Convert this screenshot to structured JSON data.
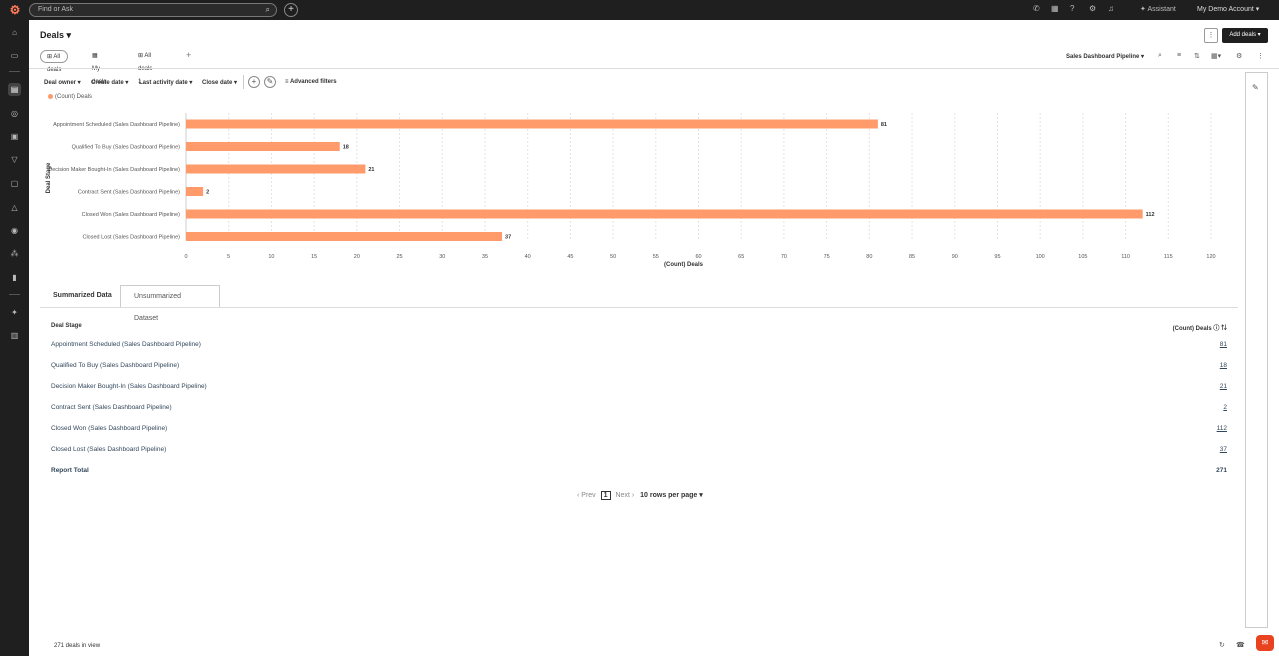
{
  "topbar": {
    "search_placeholder": "Find or Ask",
    "assistant_label": "Assistant",
    "account_label": "My Demo Account"
  },
  "header": {
    "title": "Deals",
    "add_deals_label": "Add deals",
    "pipeline_label": "Sales Dashboard Pipeline",
    "views": [
      "All deals",
      "My deals",
      "All deals-1"
    ]
  },
  "filters": {
    "items": [
      "Deal owner",
      "Create date",
      "Last activity date",
      "Close date"
    ],
    "advanced_label": "Advanced filters"
  },
  "legend": {
    "label": "(Count) Deals"
  },
  "chart_data": {
    "type": "bar",
    "orientation": "horizontal",
    "categories": [
      "Appointment Scheduled (Sales Dashboard Pipeline)",
      "Qualified To Buy (Sales Dashboard Pipeline)",
      "Decision Maker Bought-In (Sales Dashboard Pipeline)",
      "Contract Sent (Sales Dashboard Pipeline)",
      "Closed Won (Sales Dashboard Pipeline)",
      "Closed Lost (Sales Dashboard Pipeline)"
    ],
    "values": [
      81,
      18,
      21,
      2,
      112,
      37
    ],
    "xlabel": "(Count) Deals",
    "ylabel": "Deal Stage",
    "xlim": [
      0,
      120
    ],
    "xticks": [
      0,
      5,
      10,
      15,
      20,
      25,
      30,
      35,
      40,
      45,
      50,
      55,
      60,
      65,
      70,
      75,
      80,
      85,
      90,
      95,
      100,
      105,
      110,
      115,
      120
    ],
    "color": "#ff9a6a",
    "grid": true
  },
  "data_tabs": [
    "Summarized Data",
    "Unsummarized Dataset"
  ],
  "table": {
    "col_stage": "Deal Stage",
    "col_count": "(Count) Deals",
    "rows": [
      {
        "label": "Appointment Scheduled (Sales Dashboard Pipeline)",
        "value": "81"
      },
      {
        "label": "Qualified To Buy (Sales Dashboard Pipeline)",
        "value": "18"
      },
      {
        "label": "Decision Maker Bought-In (Sales Dashboard Pipeline)",
        "value": "21"
      },
      {
        "label": "Contract Sent (Sales Dashboard Pipeline)",
        "value": "2"
      },
      {
        "label": "Closed Won (Sales Dashboard Pipeline)",
        "value": "112"
      },
      {
        "label": "Closed Lost (Sales Dashboard Pipeline)",
        "value": "37"
      }
    ],
    "total_label": "Report Total",
    "total_value": "271"
  },
  "pagination": {
    "prev": "Prev",
    "current": "1",
    "next": "Next",
    "rows_per_page": "10 rows per page"
  },
  "footer": {
    "count_text": "271 deals in view"
  }
}
